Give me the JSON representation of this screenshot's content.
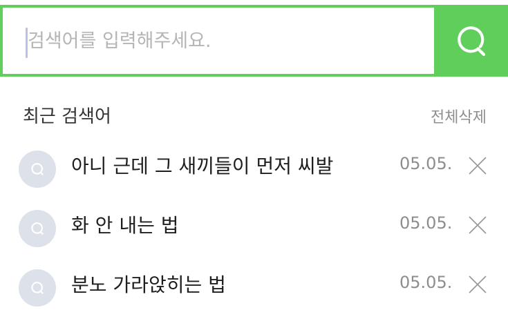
{
  "search": {
    "placeholder": "검색어를 입력해주세요.",
    "value": "",
    "button_icon": "search-icon"
  },
  "recent": {
    "title": "최근 검색어",
    "clear_all_label": "전체삭제",
    "items": [
      {
        "text": "아니 근데 그 새끼들이 먼저 씨발",
        "date": "05.05."
      },
      {
        "text": "화 안 내는 법",
        "date": "05.05."
      },
      {
        "text": "분노 가라앉히는 법",
        "date": "05.05."
      }
    ],
    "item_icon": "history-search-icon",
    "delete_icon": "close-icon"
  },
  "colors": {
    "accent": "#5fce5b",
    "icon_bg": "#dde1ea",
    "muted_text": "#8d8d8d"
  }
}
